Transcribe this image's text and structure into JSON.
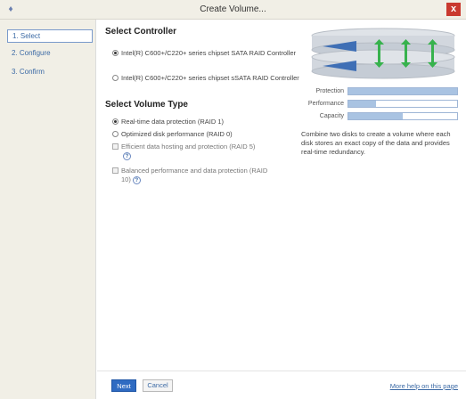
{
  "window": {
    "title": "Create Volume...",
    "app_icon": "raid-app-icon",
    "close_glyph": "x"
  },
  "sidebar": {
    "items": [
      {
        "label": "1. Select",
        "active": true
      },
      {
        "label": "2. Configure",
        "active": false
      },
      {
        "label": "3. Confirm",
        "active": false
      }
    ]
  },
  "controller": {
    "heading": "Select Controller",
    "options": [
      {
        "label": "Intel(R) C600+/C220+ series chipset SATA RAID Controller",
        "selected": true
      },
      {
        "label": "Intel(R) C600+/C220+ series chipset sSATA RAID Controller",
        "selected": false
      }
    ]
  },
  "volume_type": {
    "heading": "Select Volume Type",
    "options": [
      {
        "label": "Real-time data protection (RAID 1)",
        "kind": "radio",
        "selected": true,
        "enabled": true
      },
      {
        "label": "Optimized disk performance (RAID 0)",
        "kind": "radio",
        "selected": false,
        "enabled": true
      },
      {
        "label": "Efficient data hosting and protection (RAID 5)",
        "kind": "checkbox",
        "selected": false,
        "enabled": false,
        "help": true
      },
      {
        "label": "Balanced performance and data protection (RAID 10)",
        "kind": "checkbox",
        "selected": false,
        "enabled": false,
        "help": true
      }
    ]
  },
  "metrics": [
    {
      "label": "Protection",
      "level": 1.0
    },
    {
      "label": "Performance",
      "level": 0.25
    },
    {
      "label": "Capacity",
      "level": 0.5
    }
  ],
  "description": "Combine two disks to create a volume where each disk stores an exact copy of the data and provides real-time redundancy.",
  "footer": {
    "next_label": "Next",
    "cancel_label": "Cancel",
    "help_link": "More help on this page"
  },
  "colors": {
    "accent": "#2f6bc2",
    "link": "#3c6aa5",
    "sidebar_bg": "#f1efe6",
    "bar_fill": "#a9c3e2",
    "close": "#c9392f"
  }
}
